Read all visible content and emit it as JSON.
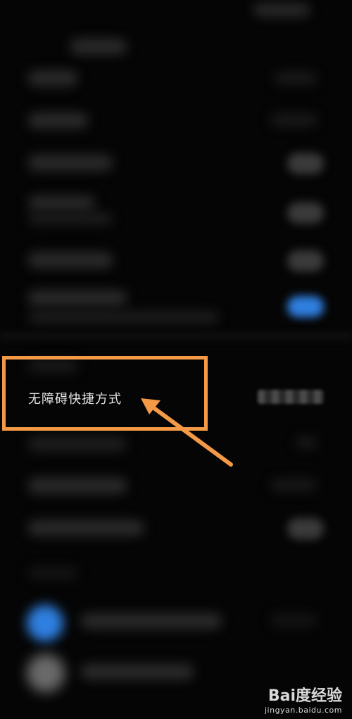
{
  "highlighted_item": {
    "label": "无障碍快捷方式"
  },
  "watermark": {
    "brand": "Bai度经验",
    "site": "jingyan.baidu.com"
  },
  "colors": {
    "highlight": "#f49a47",
    "toggle_on": "#2f7fe0",
    "background": "#050505"
  }
}
